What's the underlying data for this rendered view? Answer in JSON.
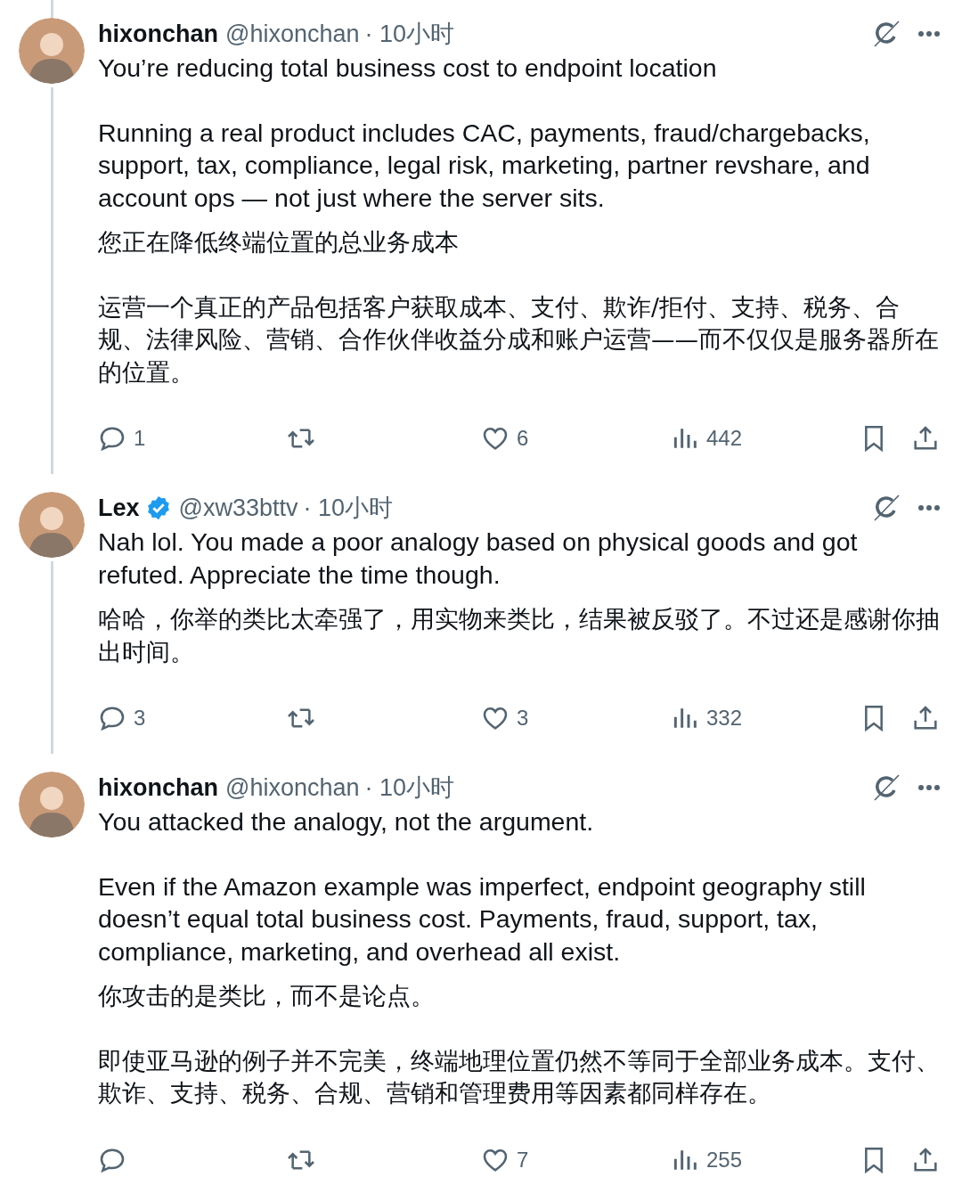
{
  "tweets": [
    {
      "name": "hixonchan",
      "handle": "@hixonchan",
      "time": "· 10小时",
      "verified": false,
      "thread_line_above": true,
      "thread_line_below": true,
      "text": [
        "You’re reducing total business cost to endpoint location",
        "Running a real product includes CAC, payments, fraud/chargebacks, support, tax, compliance, legal risk, marketing, partner revshare, and account ops — not just where the server sits."
      ],
      "translation": [
        "您正在降低终端位置的总业务成本",
        "运营一个真正的产品包括客户获取成本、支付、欺诈/拒付、支持、税务、合规、法律风险、营销、合作伙伴收益分成和账户运营——而不仅仅是服务器所在的位置。"
      ],
      "replies": "1",
      "likes": "6",
      "views": "442"
    },
    {
      "name": "Lex",
      "handle": "@xw33bttv",
      "time": "· 10小时",
      "verified": true,
      "thread_line_above": false,
      "thread_line_below": true,
      "text": [
        "Nah lol. You made a poor analogy based on physical goods and got refuted. Appreciate the time though."
      ],
      "translation": [
        "哈哈，你举的类比太牵强了，用实物来类比，结果被反驳了。不过还是感谢你抽出时间。"
      ],
      "replies": "3",
      "likes": "3",
      "views": "332"
    },
    {
      "name": "hixonchan",
      "handle": "@hixonchan",
      "time": "· 10小时",
      "verified": false,
      "thread_line_above": false,
      "thread_line_below": false,
      "text": [
        "You attacked the analogy, not the argument.",
        "Even if the Amazon example was imperfect, endpoint geography still doesn’t equal total business cost. Payments, fraud, support, tax, compliance, marketing, and overhead all exist."
      ],
      "translation": [
        "你攻击的是类比，而不是论点。",
        "即使亚马逊的例子并不完美，终端地理位置仍然不等同于全部业务成本。支付、欺诈、支持、税务、合规、营销和管理费用等因素都同样存在。"
      ],
      "likes": "7",
      "views": "255"
    }
  ]
}
